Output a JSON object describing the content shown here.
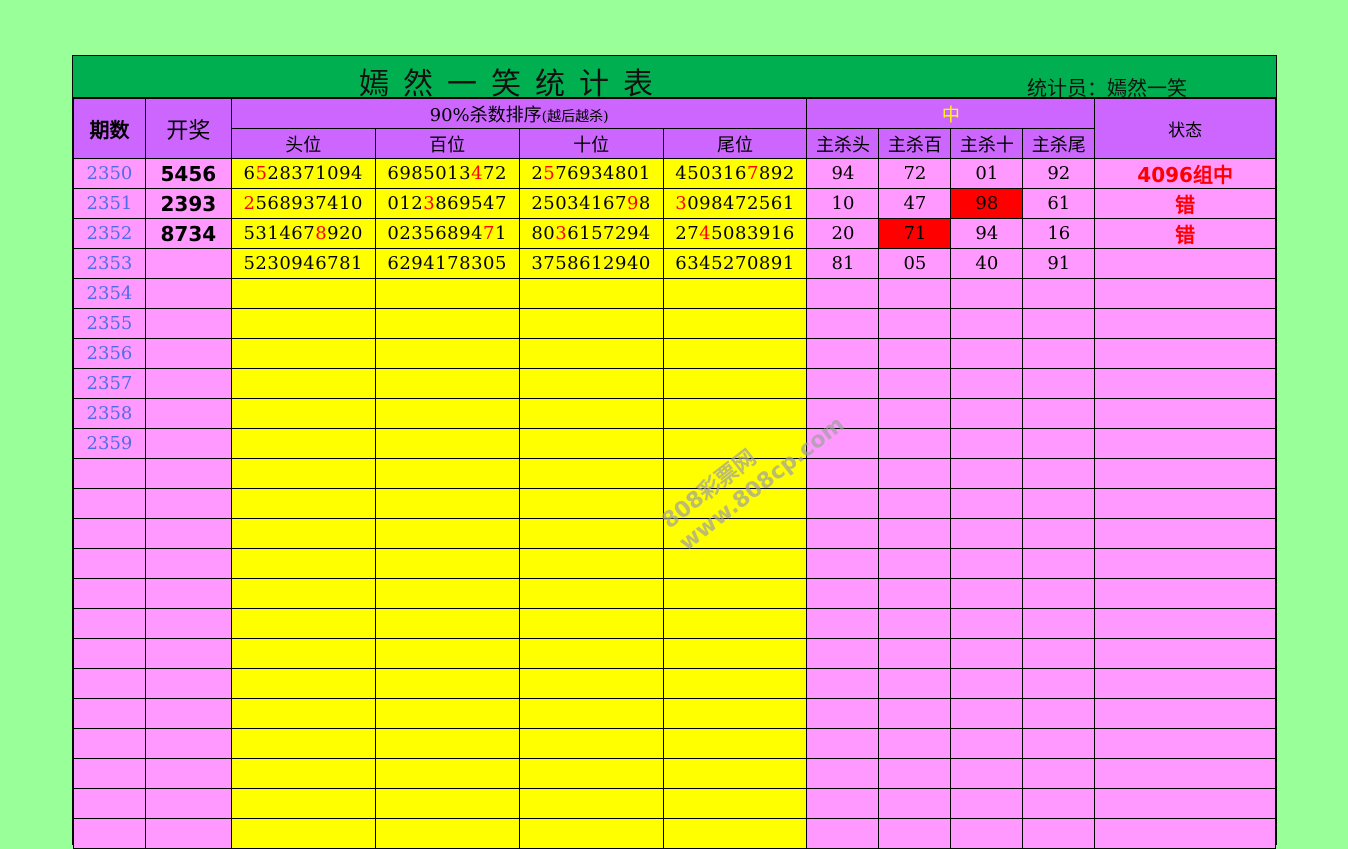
{
  "title": "嫣然一笑统计表",
  "statistician": "统计员：嫣然一笑",
  "headers": {
    "issue": "期数",
    "draw": "开奖",
    "sort_title": "90%杀数排序",
    "sort_sub": "(越后越杀)",
    "positions": [
      "头位",
      "百位",
      "十位",
      "尾位"
    ],
    "hit_label": "中",
    "kills": [
      "主杀头",
      "主杀百",
      "主杀十",
      "主杀尾"
    ],
    "status": "状态"
  },
  "rows": [
    {
      "issue": "2350",
      "draw": "5456",
      "seqs": [
        [
          "6",
          "5",
          "28371094"
        ],
        [
          "6985013",
          "4",
          "72"
        ],
        [
          "2",
          "5",
          "76934801"
        ],
        [
          "450316",
          "7",
          "892"
        ]
      ],
      "kills": [
        "94",
        "72",
        "01",
        "92"
      ],
      "kill_red": [
        false,
        false,
        false,
        false
      ],
      "status": "4096组中"
    },
    {
      "issue": "2351",
      "draw": "2393",
      "seqs": [
        [
          "",
          "2",
          "568937410"
        ],
        [
          "012",
          "3",
          "869547"
        ],
        [
          "25034167",
          "9",
          "8"
        ],
        [
          "",
          "3",
          "098472561"
        ]
      ],
      "kills": [
        "10",
        "47",
        "98",
        "61"
      ],
      "kill_red": [
        false,
        false,
        true,
        false
      ],
      "status": "错"
    },
    {
      "issue": "2352",
      "draw": "8734",
      "seqs": [
        [
          "531467",
          "8",
          "920"
        ],
        [
          "02356894",
          "7",
          "1"
        ],
        [
          "80",
          "3",
          "6157294"
        ],
        [
          "27",
          "4",
          "5083916"
        ]
      ],
      "kills": [
        "20",
        "71",
        "94",
        "16"
      ],
      "kill_red": [
        false,
        true,
        false,
        false
      ],
      "status": "错"
    },
    {
      "issue": "2353",
      "draw": "",
      "seqs": [
        [
          "5230946781",
          "",
          ""
        ],
        [
          "6294178305",
          "",
          ""
        ],
        [
          "3758612940",
          "",
          ""
        ],
        [
          "6345270891",
          "",
          ""
        ]
      ],
      "kills": [
        "81",
        "05",
        "40",
        "91"
      ],
      "kill_red": [
        false,
        false,
        false,
        false
      ],
      "status": ""
    },
    {
      "issue": "2354"
    },
    {
      "issue": "2355"
    },
    {
      "issue": "2356"
    },
    {
      "issue": "2357"
    },
    {
      "issue": "2358"
    },
    {
      "issue": "2359"
    },
    {
      "issue": ""
    },
    {
      "issue": ""
    },
    {
      "issue": ""
    },
    {
      "issue": ""
    },
    {
      "issue": ""
    },
    {
      "issue": ""
    },
    {
      "issue": ""
    },
    {
      "issue": ""
    },
    {
      "issue": ""
    },
    {
      "issue": ""
    },
    {
      "issue": ""
    },
    {
      "issue": ""
    },
    {
      "issue": ""
    }
  ],
  "watermark": [
    "808彩票网",
    "www.808cp.com"
  ]
}
